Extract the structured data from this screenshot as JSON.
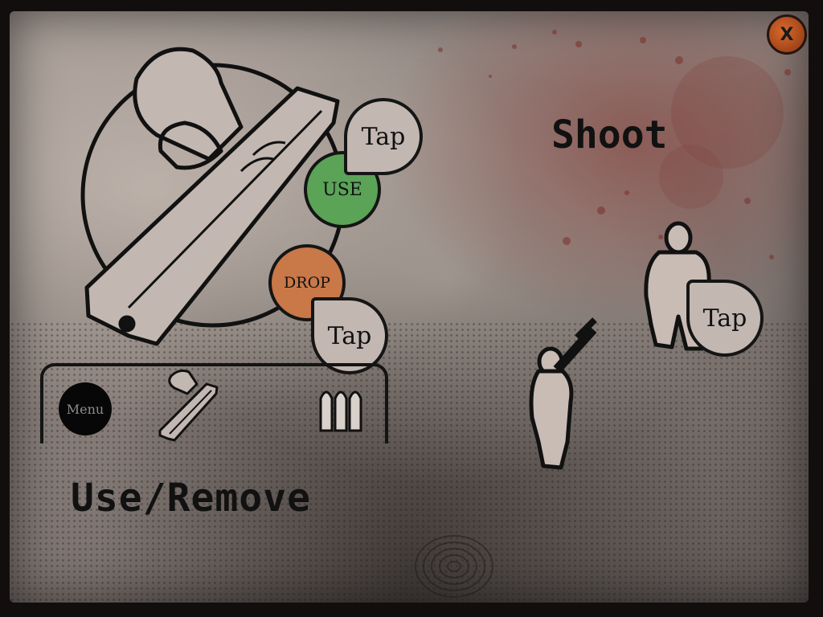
{
  "tutorial": {
    "close_label": "X",
    "inventory": {
      "use_label": "USE",
      "drop_label": "DROP",
      "tap_top": "Tap",
      "tap_bottom": "Tap",
      "menu_label": "Menu",
      "caption": "Use/Remove"
    },
    "shoot": {
      "title": "Shoot",
      "tap_label": "Tap"
    }
  },
  "colors": {
    "use_button": "#5aa357",
    "drop_button": "#c97848",
    "bubble_fill": "#c2b7b1",
    "figure_fill": "#c9bcb5",
    "close_button": "#c8571f"
  }
}
